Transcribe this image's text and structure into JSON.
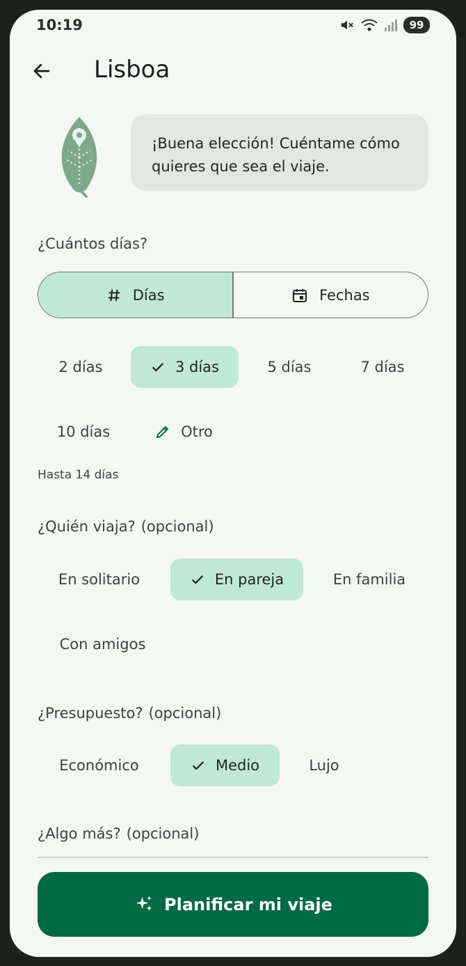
{
  "status": {
    "time": "10:19",
    "battery": "99"
  },
  "appbar": {
    "title": "Lisboa"
  },
  "assistant": {
    "message": "¡Buena elección! Cuéntame cómo quieres que sea el viaje."
  },
  "days": {
    "label": "¿Cuántos días?",
    "segments": [
      {
        "label": "Días",
        "icon": "hash-icon",
        "active": true
      },
      {
        "label": "Fechas",
        "icon": "calendar-icon",
        "active": false
      }
    ],
    "options": [
      "2 días",
      "3 días",
      "5 días",
      "7 días",
      "10 días",
      "Otro"
    ],
    "selected": "3 días",
    "helper": "Hasta 14 días"
  },
  "travelers": {
    "label": "¿Quién viaja?",
    "optional": "(opcional)",
    "options": [
      "En solitario",
      "En pareja",
      "En familia",
      "Con amigos"
    ],
    "selected": "En pareja"
  },
  "budget": {
    "label": "¿Presupuesto?",
    "optional": "(opcional)",
    "options": [
      "Económico",
      "Medio",
      "Lujo"
    ],
    "selected": "Medio"
  },
  "extra": {
    "label": "¿Algo más?",
    "optional": "(opcional)"
  },
  "cta": {
    "label": "Planificar mi viaje",
    "icon": "sparkles-icon"
  },
  "colors": {
    "accent": "#006a45",
    "chip_selected": "#c0e8d8",
    "bubble": "#e2e8e1",
    "background": "#f5f7f4"
  }
}
